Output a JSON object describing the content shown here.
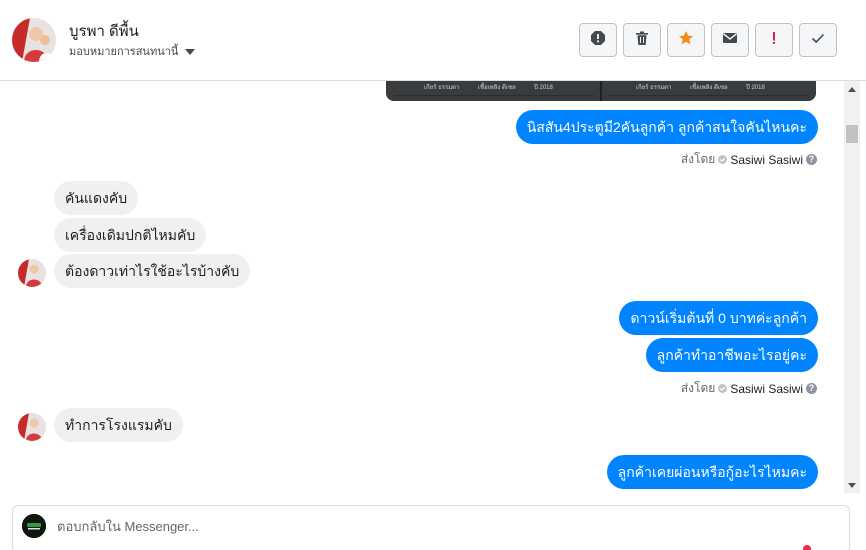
{
  "header": {
    "name": "บูรพา ดีพื้น",
    "assign_label": "มอบหมายการสนทนานี้",
    "actions": [
      {
        "name": "spam-icon"
      },
      {
        "name": "trash-icon"
      },
      {
        "name": "star-icon",
        "color": "#f28d1b"
      },
      {
        "name": "mail-icon"
      },
      {
        "name": "exclamation-icon",
        "color": "#e41e3f"
      },
      {
        "name": "check-icon"
      }
    ]
  },
  "image_card": {
    "captions": [
      "เกียร์ ธรรมดา",
      "เชื้อเพลิง ดีเซล",
      "ปี 2018",
      "เกียร์ ธรรมดา",
      "เชื้อเพลิง ดีเซล",
      "ปี 2018"
    ]
  },
  "messages": [
    {
      "text": "นิสสัน4ประตูมี2คันลูกค้า ลูกค้าสนใจคันไหนคะ"
    },
    {
      "text": "คันแดงคับ"
    },
    {
      "text": "เครื่องเดิมปกติไหมคับ"
    },
    {
      "text": "ต้องดาวเท่าไรใช้อะไรบ้างคับ"
    },
    {
      "text": "ดาวน์เริ่มต้นที่ 0 บาทค่ะลูกค้า"
    },
    {
      "text": "ลูกค้าทำอาชีพอะไรอยู่คะ"
    },
    {
      "text": "ทำการโรงแรมคับ"
    },
    {
      "text": "ลูกค้าเคยผ่อนหรือกู้อะไรไหมคะ"
    }
  ],
  "sent_by": {
    "prefix": "ส่งโดย",
    "sender": "Sasiwi Sasiwi",
    "help": "?"
  },
  "composer": {
    "placeholder": "ตอบกลับใน Messenger..."
  },
  "colors": {
    "outgoing": "#0084ff",
    "incoming": "#f1f0f0",
    "notification_dot": "#f02849"
  }
}
